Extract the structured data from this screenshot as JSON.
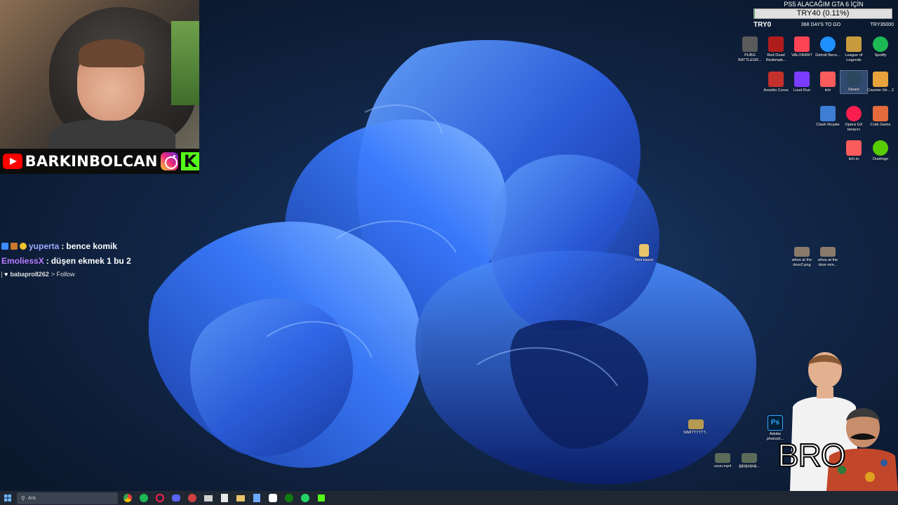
{
  "stream": {
    "channel_name": "BARKINBOLCAN",
    "overlay_text": "BRO"
  },
  "goal": {
    "title": "PS5 ALACAĞIM GTA 6 İÇİN",
    "amount_label": "TRY40 (0.11%)",
    "progress_fraction": 0.0011,
    "current": "TRY0",
    "days_left": "368 DAYS TO GO",
    "target": "TRY35000"
  },
  "chat": {
    "messages": [
      {
        "user": "yuperta",
        "separator": ":",
        "text": "bence komik",
        "user_color": "#9aa9ff"
      },
      {
        "user": "EmoliessX",
        "separator": ":",
        "text": "düşen ekmek 1 bu 2",
        "user_color": "#b77bff"
      }
    ],
    "follow": {
      "user": "babapro8262",
      "action": "> Follow"
    }
  },
  "desktop_icons": [
    {
      "label": "PUBG BATTLEGR...",
      "icon": "pubg-icon",
      "color": "#5a5a5a"
    },
    {
      "label": "Red Dead Redempti...",
      "icon": "rdr-icon",
      "color": "#b01c1c"
    },
    {
      "label": "VALORANT",
      "icon": "valorant-icon",
      "color": "#fa4454"
    },
    {
      "label": "Detroit Beco...",
      "icon": "detroit-icon",
      "color": "#1e90ff"
    },
    {
      "label": "League of Legends",
      "icon": "lol-icon",
      "color": "#c89b3c"
    },
    {
      "label": "Spotify",
      "icon": "spotify-icon",
      "color": "#1db954"
    },
    {
      "label": "Assetto Corsa",
      "icon": "assetto-icon",
      "color": "#c4302b"
    },
    {
      "label": "Loud Run",
      "icon": "loudrun-icon",
      "color": "#7a3cff"
    },
    {
      "label": "itch",
      "icon": "itch-icon",
      "color": "#fa5c5c"
    },
    {
      "label": "Steam",
      "icon": "steam-icon",
      "color": "#2a475e"
    },
    {
      "label": "Counter-Str... 2",
      "icon": "cs2-icon",
      "color": "#e8a33d"
    },
    {
      "label": "Clash Royale",
      "icon": "clashroyale-icon",
      "color": "#3d7dd6"
    },
    {
      "label": "Opera GX tarayıcı",
      "icon": "operagx-icon",
      "color": "#fa1e4e"
    },
    {
      "label": "Crab Game",
      "icon": "crabgame-icon",
      "color": "#e36b3b"
    },
    {
      "label": "itch.io",
      "icon": "itchio-icon",
      "color": "#fa5c5c"
    },
    {
      "label": "Duolingo",
      "icon": "duolingo-icon",
      "color": "#58cc02"
    },
    {
      "label": "Yeni klasör",
      "icon": "folder-icon",
      "color": "#e8c46a"
    },
    {
      "label": "whos at the door2.png",
      "icon": "image-file-icon",
      "color": "#8a7a6a"
    },
    {
      "label": "whos at the door-min...",
      "icon": "image-file-icon",
      "color": "#8a7a6a"
    },
    {
      "label": "SIMITTTTTT...",
      "icon": "image-file-icon",
      "color": "#b59a50"
    },
    {
      "label": "Adobe photosh...",
      "icon": "photoshop-icon",
      "color": "#31a8ff"
    },
    {
      "label": "uzun.mp4",
      "icon": "video-file-icon",
      "color": "#5c6a5a"
    },
    {
      "label": "ğğüğüğüğ...",
      "icon": "video-file-icon",
      "color": "#5c6a5a"
    }
  ],
  "taskbar": {
    "search_placeholder": "Ara",
    "apps": [
      {
        "name": "chrome-taskbar",
        "icon": "chrome-icon",
        "color": "#4285f4"
      },
      {
        "name": "spotify-taskbar",
        "icon": "spotify-icon",
        "color": "#1db954"
      },
      {
        "name": "opera-taskbar",
        "icon": "operagx-icon",
        "color": "#fa1e4e"
      },
      {
        "name": "discord-taskbar",
        "icon": "discord-icon",
        "color": "#5865f2"
      },
      {
        "name": "mail-taskbar",
        "icon": "mail-icon",
        "color": "#8ab4f8"
      },
      {
        "name": "obs-taskbar",
        "icon": "obs-icon",
        "color": "#d0d0d0"
      },
      {
        "name": "streamlabs-taskbar",
        "icon": "streamlabs-icon",
        "color": "#80f5d2"
      },
      {
        "name": "explorer-taskbar",
        "icon": "folder-icon",
        "color": "#e8c46a"
      },
      {
        "name": "calculator-taskbar",
        "icon": "calculator-icon",
        "color": "#6ea8ff"
      },
      {
        "name": "capcut-taskbar",
        "icon": "capcut-icon",
        "color": "#ffffff"
      },
      {
        "name": "xbox-taskbar",
        "icon": "xbox-icon",
        "color": "#107c10"
      },
      {
        "name": "whatsapp-taskbar",
        "icon": "whatsapp-icon",
        "color": "#25d366"
      },
      {
        "name": "kick-taskbar",
        "icon": "kick-icon",
        "color": "#53fc18"
      }
    ]
  }
}
